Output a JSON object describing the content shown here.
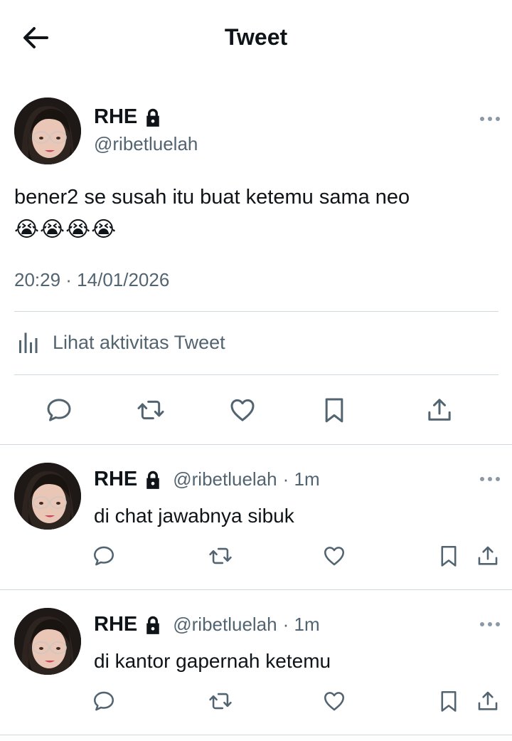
{
  "header": {
    "title": "Tweet",
    "back_icon": "arrow-left-icon"
  },
  "main_tweet": {
    "name": "RHE",
    "handle": "@ribetluelah",
    "text": "bener2 se susah itu buat ketemu sama neo",
    "emojis": "😭😭😭😭",
    "timestamp": "20:29 · 14/01/2026",
    "analytics_label": "Lihat aktivitas Tweet"
  },
  "replies": [
    {
      "name": "RHE",
      "handle": "@ribetluelah",
      "time": "· 1m",
      "text": "di chat jawabnya sibuk"
    },
    {
      "name": "RHE",
      "handle": "@ribetluelah",
      "time": "· 1m",
      "text": "di kantor gapernah ketemu"
    }
  ],
  "colors": {
    "text": "#0f1419",
    "secondary": "#536471",
    "divider": "#cfd9de",
    "more": "#8b98a5"
  }
}
